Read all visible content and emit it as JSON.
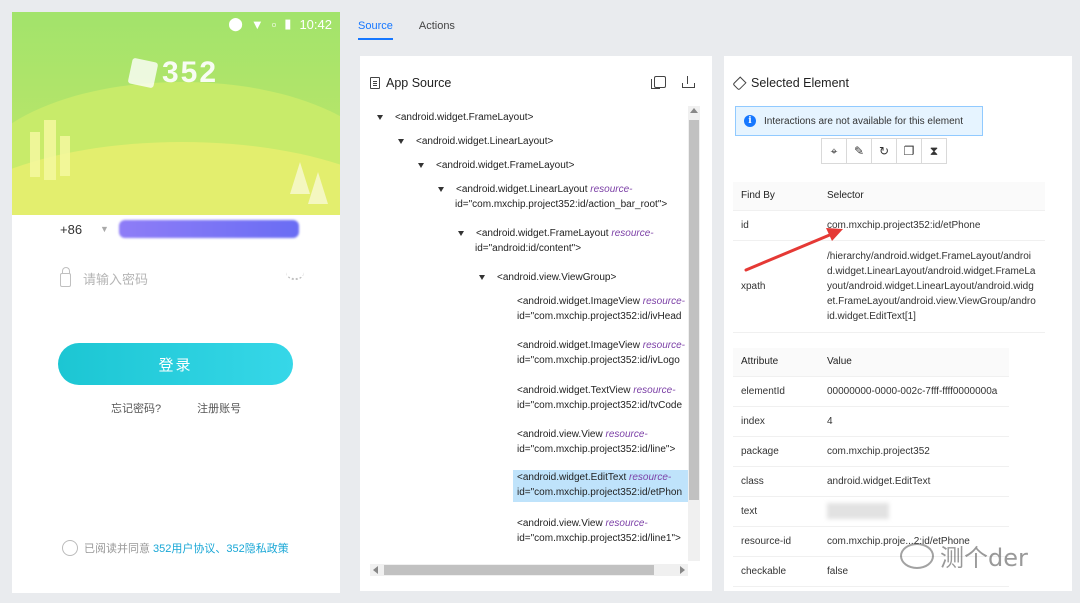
{
  "device": {
    "status_time": "10:42",
    "logo_text": "352",
    "country_code": "+86",
    "password_placeholder": "请输入密码",
    "login_button": "登录",
    "forgot_password": "忘记密码?",
    "register": "注册账号",
    "agree_prefix": "已阅读并同意",
    "agree_links": "352用户协议、352隐私政策"
  },
  "tabs": [
    {
      "label": "Source",
      "active": true
    },
    {
      "label": "Actions",
      "active": false
    }
  ],
  "source_panel": {
    "title": "App Source",
    "nodes": [
      {
        "tag": "<android.widget.FrameLayout>"
      },
      {
        "tag": "<android.widget.LinearLayout>"
      },
      {
        "tag": "<android.widget.FrameLayout>"
      },
      {
        "tag": "<android.widget.LinearLayout",
        "attr": "resource-",
        "id_line": "id=\"com.mxchip.project352:id/action_bar_root\">"
      },
      {
        "tag": "<android.widget.FrameLayout",
        "attr": "resource-",
        "id_line": "id=\"android:id/content\">"
      },
      {
        "tag": "<android.view.ViewGroup>"
      },
      {
        "tag": "<android.widget.ImageView",
        "attr": "resource-",
        "id_line": "id=\"com.mxchip.project352:id/ivHead"
      },
      {
        "tag": "<android.widget.ImageView",
        "attr": "resource-",
        "id_line": "id=\"com.mxchip.project352:id/ivLogo"
      },
      {
        "tag": "<android.widget.TextView",
        "attr": "resource-",
        "id_line": "id=\"com.mxchip.project352:id/tvCode"
      },
      {
        "tag": "<android.view.View",
        "attr": "resource-",
        "id_line": "id=\"com.mxchip.project352:id/line\">"
      },
      {
        "tag": "<android.widget.EditText",
        "attr": "resource-",
        "id_line": "id=\"com.mxchip.project352:id/etPhon"
      },
      {
        "tag": "<android.view.View",
        "attr": "resource-",
        "id_line": "id=\"com.mxchip.project352:id/line1\">"
      }
    ]
  },
  "selected_panel": {
    "title": "Selected Element",
    "info": "Interactions are not available for this element",
    "findby_headers": [
      "Find By",
      "Selector"
    ],
    "findby_rows": [
      {
        "key": "id",
        "value": "com.mxchip.project352:id/etPhone"
      },
      {
        "key": "xpath",
        "value": "/hierarchy/android.widget.FrameLayout/android.widget.LinearLayout/android.widget.FrameLayout/android.widget.LinearLayout/android.widget.FrameLayout/android.view.ViewGroup/android.widget.EditText[1]"
      }
    ],
    "attr_headers": [
      "Attribute",
      "Value"
    ],
    "attr_rows": [
      {
        "key": "elementId",
        "value": "00000000-0000-002c-7fff-ffff0000000a"
      },
      {
        "key": "index",
        "value": "4"
      },
      {
        "key": "package",
        "value": "com.mxchip.project352"
      },
      {
        "key": "class",
        "value": "android.widget.EditText"
      },
      {
        "key": "text",
        "value": ""
      },
      {
        "key": "resource-id",
        "value": "com.mxchip.proje...2:id/etPhone"
      },
      {
        "key": "checkable",
        "value": "false"
      }
    ]
  },
  "watermark": "测个der",
  "colors": {
    "accent": "#1677ff",
    "login_button": "#1cc6d3",
    "selected_row": "#bfe3fb",
    "annotation_arrow": "#e53935"
  }
}
